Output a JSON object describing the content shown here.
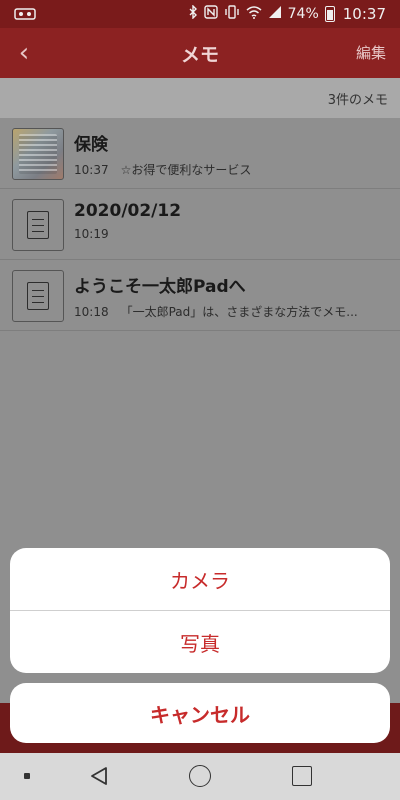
{
  "status_bar": {
    "battery_percent": "74%",
    "time": "10:37",
    "icons": [
      "bluetooth-icon",
      "nfc-icon",
      "vibrate-icon",
      "wifi-icon",
      "signal-icon",
      "battery-icon"
    ]
  },
  "header": {
    "back_icon": "chevron-left-icon",
    "title": "メモ",
    "edit_label": "編集"
  },
  "list": {
    "count_label": "3件のメモ",
    "items": [
      {
        "title": "保険",
        "time": "10:37",
        "snippet": "☆お得で便利なサービス",
        "thumbnail": "photo"
      },
      {
        "title": "2020/02/12",
        "time": "10:19",
        "snippet": "",
        "thumbnail": "document-icon"
      },
      {
        "title": "ようこそ一太郎Padへ",
        "time": "10:18",
        "snippet": "「一太郎Pad」は、さまざまな方法でメモ...",
        "thumbnail": "document-icon"
      }
    ]
  },
  "action_sheet": {
    "camera_label": "カメラ",
    "photo_label": "写真",
    "cancel_label": "キャンセル"
  },
  "colors": {
    "header_bg": "#8c2222",
    "accent_red": "#c72b2b",
    "overlay_gray": "#8f8f8f"
  },
  "navigation_bar": {
    "icons": [
      "square-dot-icon",
      "back-triangle-icon",
      "home-circle-icon",
      "recents-square-icon"
    ]
  }
}
